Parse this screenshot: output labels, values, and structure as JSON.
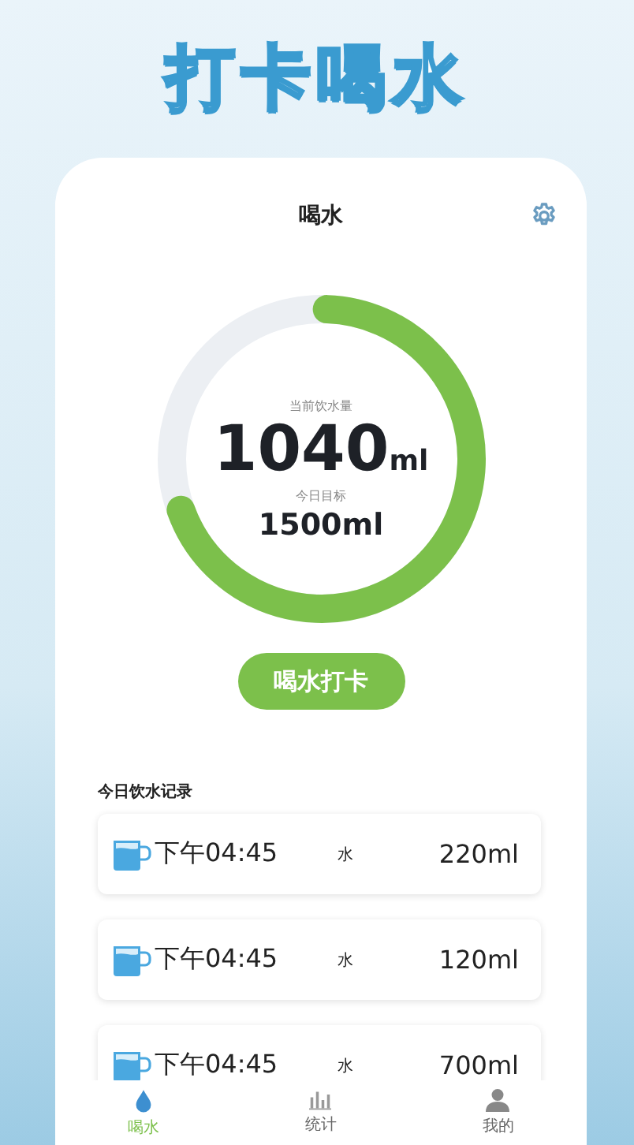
{
  "headline": "打卡喝水",
  "app_bar": {
    "title": "喝水"
  },
  "progress": {
    "label": "当前饮水量",
    "value": "1040",
    "unit": "ml",
    "goal_label": "今日目标",
    "goal": "1500ml",
    "level": 0.69
  },
  "checkin_button": "喝水打卡",
  "records": {
    "title": "今日饮水记录",
    "items": [
      {
        "time": "下午04:45",
        "drink": "水",
        "amount": "220ml"
      },
      {
        "time": "下午04:45",
        "drink": "水",
        "amount": "120ml"
      },
      {
        "time": "下午04:45",
        "drink": "水",
        "amount": "700ml"
      }
    ]
  },
  "tabs": [
    {
      "label": "喝水",
      "kind": "drop",
      "selected": true
    },
    {
      "label": "统计",
      "kind": "chart",
      "selected": false
    },
    {
      "label": "我的",
      "kind": "person",
      "selected": false
    }
  ]
}
